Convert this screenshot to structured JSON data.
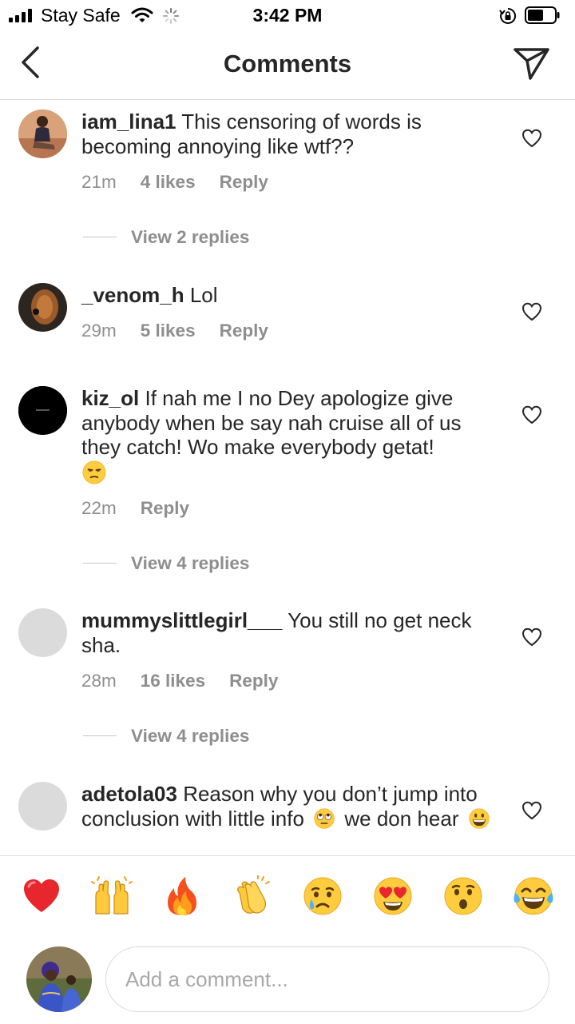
{
  "status_bar": {
    "carrier": "Stay Safe",
    "time": "3:42 PM",
    "icons": [
      "signal-bars-icon",
      "wifi-icon",
      "activity-spinner-icon",
      "orientation-lock-icon",
      "battery-icon"
    ]
  },
  "nav": {
    "title": "Comments",
    "back_icon": "chevron-left-icon",
    "share_icon": "send-icon"
  },
  "comments": [
    {
      "username": "iam_lina1",
      "text": "This censoring of words is becoming annoying like wtf??",
      "time": "21m",
      "likes": "4 likes",
      "reply_label": "Reply",
      "view_replies": "View 2 replies"
    },
    {
      "username": "_venom_h",
      "text": "Lol",
      "time": "29m",
      "likes": "5 likes",
      "reply_label": "Reply"
    },
    {
      "username": "kiz_ol",
      "text": "If nah me I no Dey apologize give anybody when be say nah cruise all of us they catch! Wo make everybody getat!",
      "emoji": "unamused-face",
      "time": "22m",
      "reply_label": "Reply",
      "view_replies": "View 4 replies"
    },
    {
      "username": "mummyslittlegirl___",
      "text": "You still no get neck sha.",
      "time": "28m",
      "likes": "16 likes",
      "reply_label": "Reply",
      "view_replies": "View 4 replies"
    },
    {
      "username": "adetola03",
      "text_part1": "Reason why you don’t jump into conclusion with little info",
      "emoji1": "face-with-rolling-eyes",
      "text_part2": "we don hear",
      "emoji2": "grinning-face"
    }
  ],
  "reactions": [
    "red-heart",
    "raising-hands",
    "fire",
    "clapping-hands",
    "crying-face",
    "heart-eyes",
    "hushed-face",
    "tears-of-joy"
  ],
  "composer": {
    "placeholder": "Add a comment..."
  },
  "colors": {
    "text": "#262626",
    "secondary": "#8e8e8e",
    "divider": "#dbdbdb",
    "heart_red": "#e8262e"
  }
}
